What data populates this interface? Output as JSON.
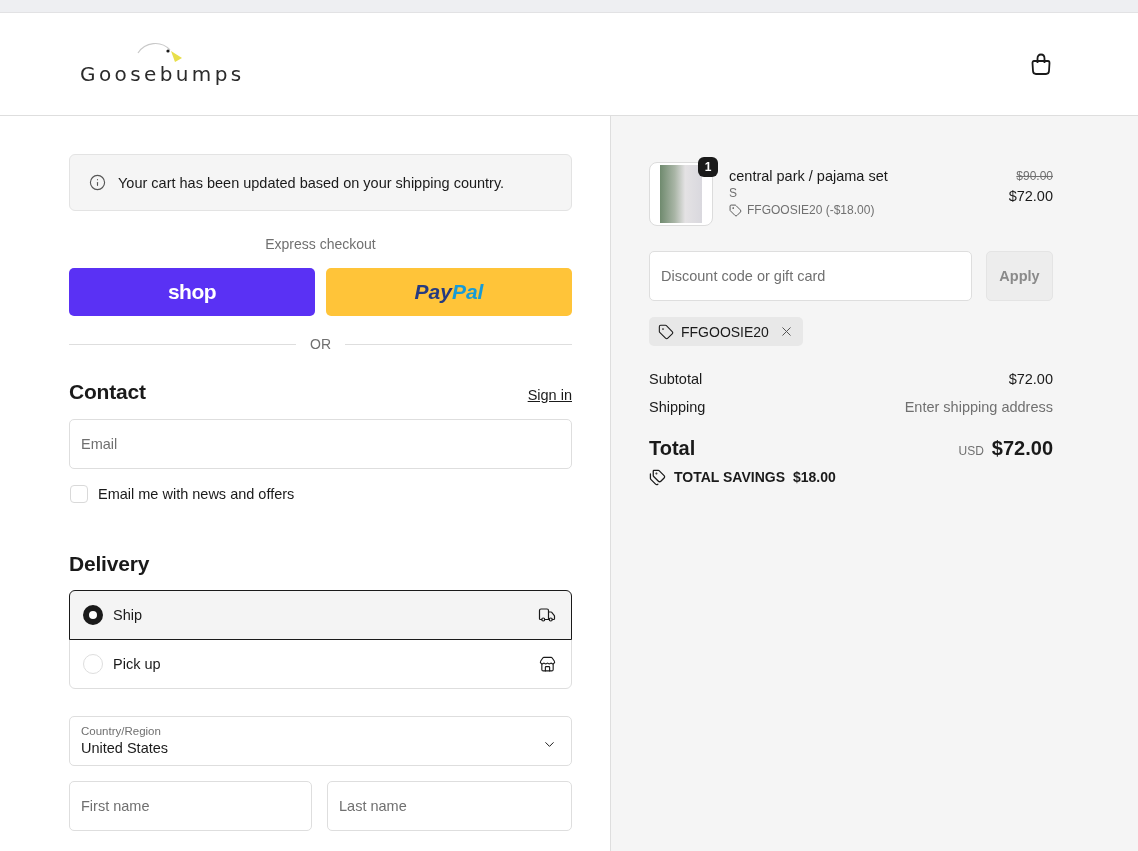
{
  "header": {
    "logo": "Goosebumps"
  },
  "notice": {
    "text": "Your cart has been updated based on your shipping country."
  },
  "express_checkout": {
    "title": "Express checkout",
    "buttons": [
      {
        "kind": "shop",
        "label_parts": [
          "shop"
        ]
      },
      {
        "kind": "paypal",
        "label_parts": [
          "Pay",
          "Pal"
        ]
      }
    ],
    "divider": "OR"
  },
  "contact": {
    "title": "Contact",
    "sign_in": "Sign in",
    "email": {
      "placeholder": "Email"
    },
    "newsletter": {
      "label": "Email me with news and offers",
      "checked": false
    }
  },
  "delivery": {
    "title": "Delivery",
    "options": [
      {
        "kind": "ship",
        "label": "Ship",
        "selected": true
      },
      {
        "kind": "pickup",
        "label": "Pick up",
        "selected": false
      }
    ],
    "country": {
      "label": "Country/Region",
      "value": "United States"
    },
    "name_fields": [
      {
        "placeholder": "First name"
      },
      {
        "placeholder": "Last name"
      }
    ]
  },
  "order_summary": {
    "items": [
      {
        "quantity": "1",
        "name": "central park / pajama set",
        "variant": "S",
        "discount": "FFGOOSIE20 (-$18.00)",
        "original_price": "$90.00",
        "price": "$72.00"
      }
    ],
    "discount_field": {
      "placeholder": "Discount code or gift card"
    },
    "apply_button": {
      "label": "Apply",
      "disabled": true
    },
    "applied_codes": [
      "FFGOOSIE20"
    ],
    "lines": [
      {
        "kind": "amount",
        "label": "Subtotal",
        "value": "$72.00"
      },
      {
        "kind": "note",
        "label": "Shipping",
        "value": "Enter shipping address"
      }
    ],
    "total": {
      "label": "Total",
      "currency": "USD",
      "value": "$72.00"
    },
    "savings": {
      "label": "TOTAL SAVINGS",
      "value": "$18.00"
    }
  }
}
